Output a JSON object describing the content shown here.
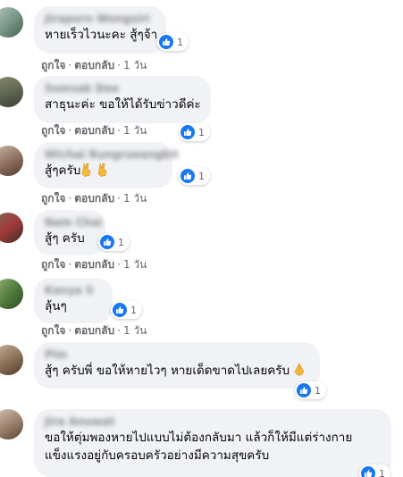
{
  "comments": [
    {
      "name": "Jiraporn Wongsiri",
      "text": "หายเร็วไวนะคะ สู้ๆจ้า",
      "likes": "1",
      "like_label": "ถูกใจ",
      "reply_label": "ตอบกลับ",
      "time": "1 วัน"
    },
    {
      "name": "Somsak Dee",
      "text": "สาธุนะค่ะ ขอให้ได้รับข่าวดีค่ะ",
      "likes": "1",
      "like_label": "ถูกใจ",
      "reply_label": "ตอบกลับ",
      "time": "1 วัน"
    },
    {
      "name": "Wichai Rungrueangkit",
      "text": "สู้ๆครับ",
      "likes": "1",
      "like_label": "ถูกใจ",
      "reply_label": "ตอบกลับ",
      "time": "1 วัน"
    },
    {
      "name": "Nam Chai",
      "text": "สู้ๆ ครับ",
      "likes": "1",
      "like_label": "ถูกใจ",
      "reply_label": "ตอบกลับ",
      "time": "1 วัน"
    },
    {
      "name": "Kanya S",
      "text": "ลุ้นๆ",
      "likes": "1",
      "like_label": "ถูกใจ",
      "reply_label": "ตอบกลับ",
      "time": "1 วัน"
    },
    {
      "name": "Pim",
      "text": "สู้ๆ ครับพี่ ขอให้หายไวๆ หายเด็ดขาดไปเลยครับ",
      "likes": "1",
      "like_label": "ถูกใจ",
      "reply_label": "ตอบกลับ",
      "time": "1 วัน"
    },
    {
      "name": "Jira Anuwat",
      "text_line1": "ขอให้ตุ่มพองหายไปแบบไม่ต้องกลับมา แล้วก็ให้มีแต่ร่างกาย",
      "text_line2": "แข็งแรงอยู่กับครอบครัวอย่างมีความสุขครับ",
      "likes": "1"
    }
  ],
  "colors": {
    "bubble": "#f0f2f5",
    "like_blue": "#1877f2",
    "meta_gray": "#65676b",
    "text": "#050505"
  },
  "icons": {
    "reaction": "thumbs-up-icon",
    "victory": "victory-hand-icon",
    "pray": "folded-hands-icon"
  }
}
